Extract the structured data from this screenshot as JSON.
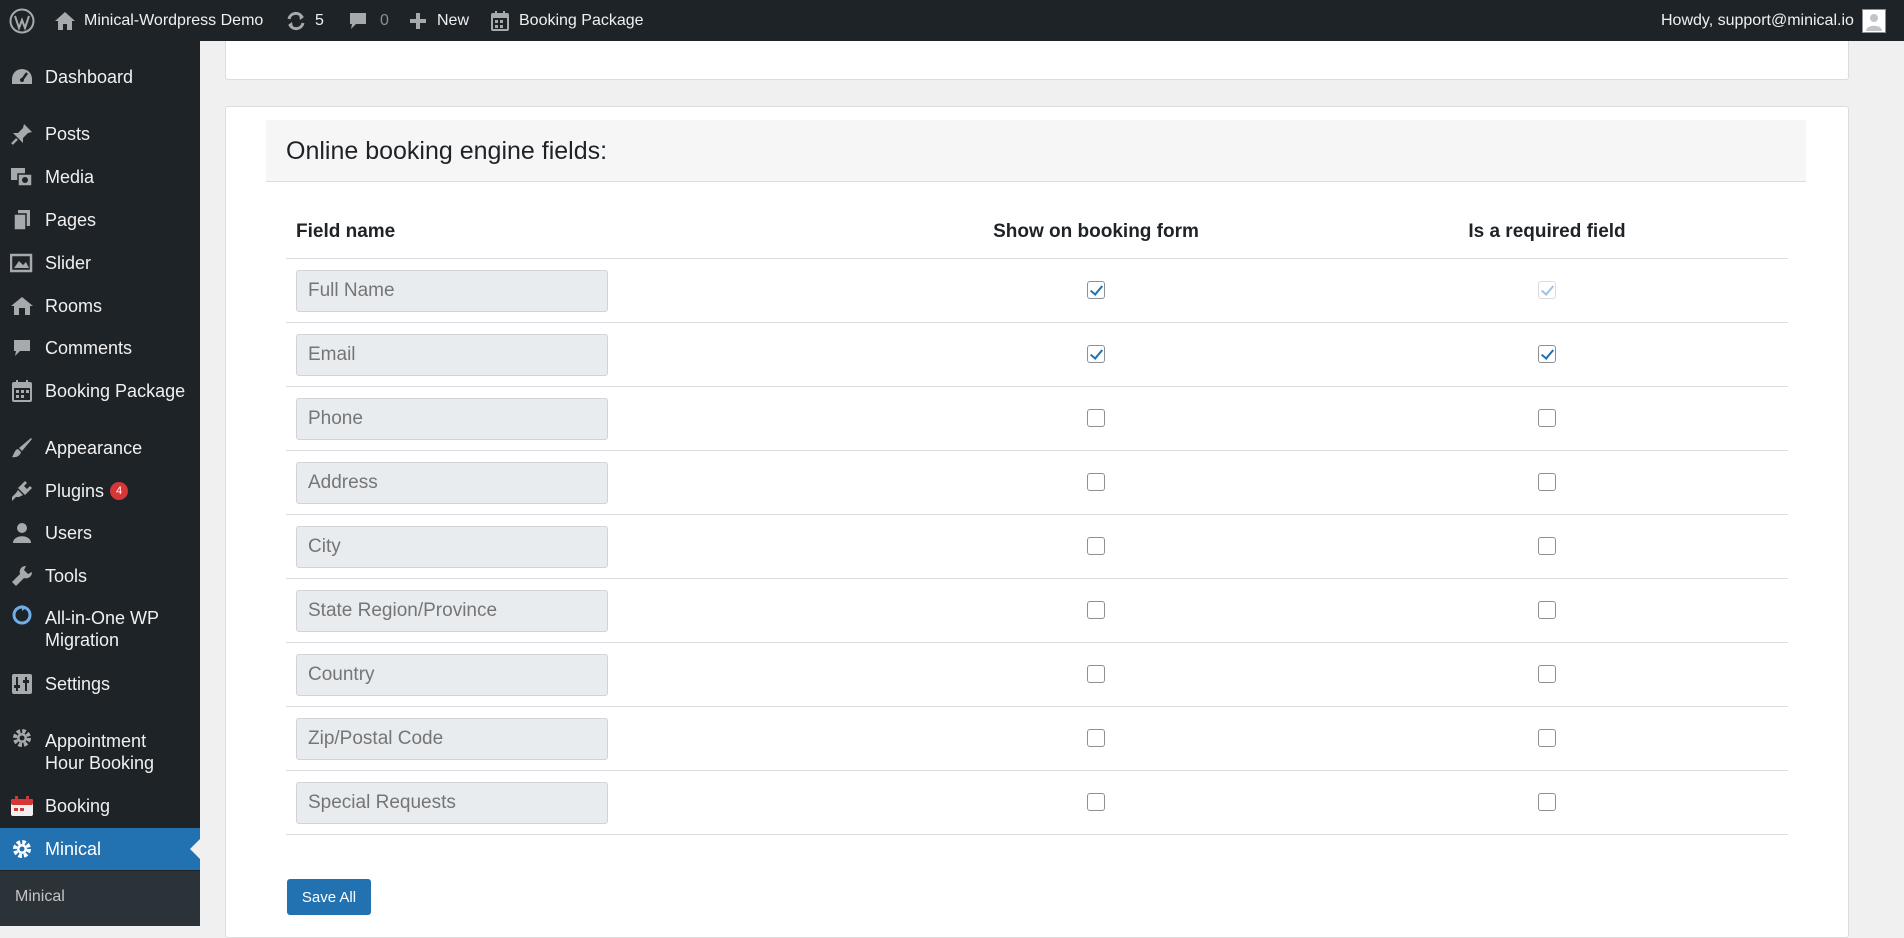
{
  "adminbar": {
    "site_name": "Minical-Wordpress Demo",
    "updates_count": "5",
    "comments_count": "0",
    "new_label": "New",
    "booking_label": "Booking Package",
    "howdy": "Howdy, support@minical.io"
  },
  "sidebar": {
    "items": [
      {
        "label": "Dashboard",
        "icon": "dashboard-icon"
      },
      {
        "label": "Posts",
        "icon": "pin-icon"
      },
      {
        "label": "Media",
        "icon": "media-icon"
      },
      {
        "label": "Pages",
        "icon": "pages-icon"
      },
      {
        "label": "Slider",
        "icon": "slider-icon"
      },
      {
        "label": "Rooms",
        "icon": "rooms-icon"
      },
      {
        "label": "Comments",
        "icon": "comment-icon"
      },
      {
        "label": "Booking Package",
        "icon": "calendar-icon"
      },
      {
        "label": "Appearance",
        "icon": "brush-icon"
      },
      {
        "label": "Plugins",
        "icon": "plugin-icon",
        "badge": "4"
      },
      {
        "label": "Users",
        "icon": "user-icon"
      },
      {
        "label": "Tools",
        "icon": "wrench-icon"
      },
      {
        "label": "All-in-One WP Migration",
        "icon": "migration-icon"
      },
      {
        "label": "Settings",
        "icon": "settings-icon"
      },
      {
        "label": "Appointment Hour Booking",
        "icon": "gear-icon"
      },
      {
        "label": "Booking",
        "icon": "booking-calendar-icon"
      },
      {
        "label": "Minical",
        "icon": "gear-icon"
      }
    ],
    "submenu_item": "Minical"
  },
  "main": {
    "section_title": "Online booking engine fields:",
    "columns": [
      "Field name",
      "Show on booking form",
      "Is a required field"
    ],
    "rows": [
      {
        "placeholder": "Full Name",
        "show": true,
        "required": true,
        "required_disabled": true
      },
      {
        "placeholder": "Email",
        "show": true,
        "required": true,
        "required_disabled": false
      },
      {
        "placeholder": "Phone",
        "show": false,
        "required": false,
        "required_disabled": false
      },
      {
        "placeholder": "Address",
        "show": false,
        "required": false,
        "required_disabled": false
      },
      {
        "placeholder": "City",
        "show": false,
        "required": false,
        "required_disabled": false
      },
      {
        "placeholder": "State Region/Province",
        "show": false,
        "required": false,
        "required_disabled": false
      },
      {
        "placeholder": "Country",
        "show": false,
        "required": false,
        "required_disabled": false
      },
      {
        "placeholder": "Zip/Postal Code",
        "show": false,
        "required": false,
        "required_disabled": false
      },
      {
        "placeholder": "Special Requests",
        "show": false,
        "required": false,
        "required_disabled": false
      }
    ],
    "save_label": "Save All"
  },
  "colors": {
    "adminbar_bg": "#1d2327",
    "accent": "#2271b1",
    "badge": "#d63638"
  }
}
